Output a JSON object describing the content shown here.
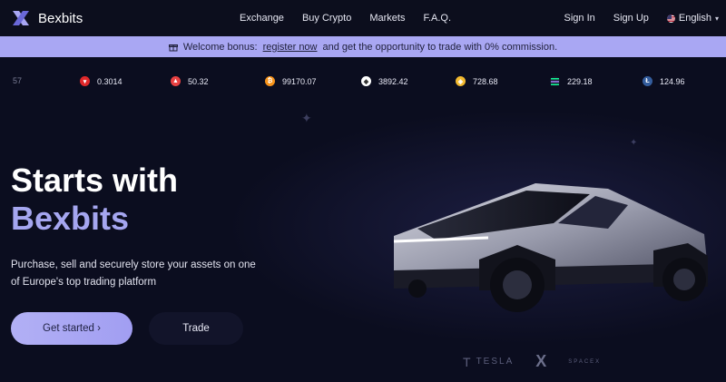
{
  "nav": {
    "brand": "Bexbits",
    "links": [
      "Exchange",
      "Buy Crypto",
      "Markets",
      "F.A.Q."
    ],
    "sign_in": "Sign In",
    "sign_up": "Sign Up",
    "language": "English"
  },
  "banner": {
    "prefix": "Welcome bonus:",
    "link": "register now",
    "suffix": "and get the opportunity to trade with 0% commission."
  },
  "ticker": [
    {
      "icon": "partial-icon",
      "value": "57",
      "color": "#1f2237"
    },
    {
      "icon": "tron-icon",
      "value": "0.3014",
      "color": "#e0282a"
    },
    {
      "icon": "avalanche-icon",
      "value": "50.32",
      "color": "#e84142"
    },
    {
      "icon": "bitcoin-icon",
      "value": "99170.07",
      "color": "#f7931a"
    },
    {
      "icon": "ethereum-icon",
      "value": "3892.42",
      "color": "#ffffff"
    },
    {
      "icon": "bnb-icon",
      "value": "728.68",
      "color": "#f3ba2f"
    },
    {
      "icon": "solana-icon",
      "value": "229.18",
      "color": "#1b1c30"
    },
    {
      "icon": "litecoin-icon",
      "value": "124.96",
      "color": "#345d9d"
    }
  ],
  "hero": {
    "title_line1": "Starts with",
    "title_line2": "Bexbits",
    "subtitle": "Purchase, sell and securely store your assets on one of Europe's top trading platform",
    "cta_primary": "Get started ›",
    "cta_secondary": "Trade"
  },
  "partners": {
    "tesla": "TESLA",
    "x": "X",
    "spacex": "SPACEX"
  },
  "colors": {
    "accent": "#a5a6f0",
    "background": "#0b0d1f",
    "banner": "#a9a7f3"
  }
}
